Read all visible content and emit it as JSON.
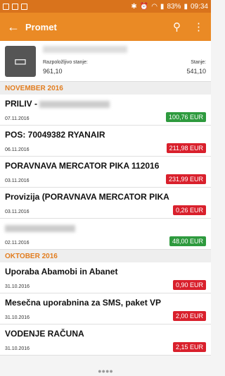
{
  "status": {
    "battery": "83%",
    "time": "09:34"
  },
  "appbar": {
    "title": "Promet"
  },
  "account": {
    "available_label": "Razpoložljivo stanje:",
    "available_value": "961,10",
    "balance_label": "Stanje:",
    "balance_value": "541,10"
  },
  "colors": {
    "positive": "#2e9a3e",
    "negative": "#d9202c",
    "accent": "#ea8a25"
  },
  "sections": [
    {
      "title": "NOVEMBER 2016",
      "items": [
        {
          "desc": "PRILIV -",
          "date": "07.11.2016",
          "amount": "100,76 EUR",
          "type": "positive",
          "blurred": true
        },
        {
          "desc": "POS: 70049382 RYANAIR",
          "date": "06.11.2016",
          "amount": "211,98 EUR",
          "type": "negative"
        },
        {
          "desc": "PORAVNAVA MERCATOR PIKA 112016",
          "date": "03.11.2016",
          "amount": "231,99 EUR",
          "type": "negative"
        },
        {
          "desc": "Provizija (PORAVNAVA MERCATOR PIKA",
          "date": "03.11.2016",
          "amount": "0,26 EUR",
          "type": "negative"
        },
        {
          "desc": "",
          "date": "02.11.2016",
          "amount": "48,00 EUR",
          "type": "positive",
          "blurred": true
        }
      ]
    },
    {
      "title": "OKTOBER 2016",
      "items": [
        {
          "desc": "Uporaba Abamobi in Abanet",
          "date": "31.10.2016",
          "amount": "0,90 EUR",
          "type": "negative"
        },
        {
          "desc": "Mesečna uporabnina za SMS, paket VP",
          "date": "31.10.2016",
          "amount": "2,00 EUR",
          "type": "negative"
        },
        {
          "desc": "VODENJE RAČUNA",
          "date": "31.10.2016",
          "amount": "2,15 EUR",
          "type": "negative"
        }
      ]
    }
  ]
}
